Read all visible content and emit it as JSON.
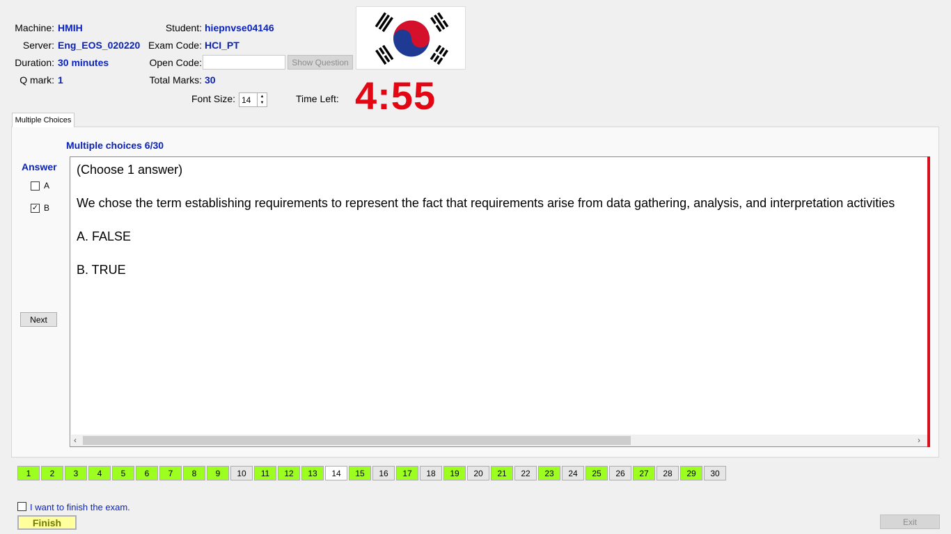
{
  "info": {
    "machine_label": "Machine:",
    "machine_value": "HMIH",
    "server_label": "Server:",
    "server_value": "Eng_EOS_020220",
    "duration_label": "Duration:",
    "duration_value": "30 minutes",
    "qmark_label": "Q mark:",
    "qmark_value": "1",
    "student_label": "Student:",
    "student_value": "hiepnvse04146",
    "exam_code_label": "Exam Code:",
    "exam_code_value": "HCI_PT",
    "open_code_label": "Open Code:",
    "open_code_value": "",
    "show_question_label": "Show Question",
    "total_marks_label": "Total Marks:",
    "total_marks_value": "30"
  },
  "font_size": {
    "label": "Font Size:",
    "value": "14"
  },
  "timer": {
    "label": "Time Left:",
    "value": "4:55"
  },
  "tab": {
    "label": "Multiple Choices"
  },
  "question": {
    "header": "Multiple choices 6/30",
    "instruction": "(Choose 1 answer)",
    "text": "We chose the term establishing requirements to represent the fact that requirements arise from data gathering, analysis, and interpretation activities",
    "options": [
      "A.  FALSE",
      "B.  TRUE"
    ]
  },
  "answer": {
    "title": "Answer",
    "choices": [
      {
        "label": "A",
        "checked": false
      },
      {
        "label": "B",
        "checked": true
      }
    ],
    "next_label": "Next"
  },
  "navigation": {
    "labels": [
      "1",
      "2",
      "3",
      "4",
      "5",
      "6",
      "7",
      "8",
      "9",
      "10",
      "11",
      "12",
      "13",
      "14",
      "15",
      "16",
      "17",
      "18",
      "19",
      "20",
      "21",
      "22",
      "23",
      "24",
      "25",
      "26",
      "27",
      "28",
      "29",
      "30"
    ],
    "answered": [
      "1",
      "2",
      "3",
      "4",
      "5",
      "6",
      "7",
      "8",
      "9",
      "11",
      "12",
      "13",
      "15",
      "17",
      "19",
      "21",
      "23",
      "25",
      "27",
      "29"
    ],
    "current": "14"
  },
  "finish": {
    "checkbox_label": "I want to finish the exam.",
    "finish_label": "Finish",
    "exit_label": "Exit"
  },
  "colors": {
    "accent": "#0a22b8",
    "timer": "#e30613",
    "answered": "#9cff1f",
    "finish_bg": "#ffff9d"
  },
  "icons": {
    "flag": "south-korea-flag-icon",
    "checkmark": "checkmark-icon",
    "scroll_left": "chevron-left-icon",
    "scroll_right": "chevron-right-icon"
  }
}
